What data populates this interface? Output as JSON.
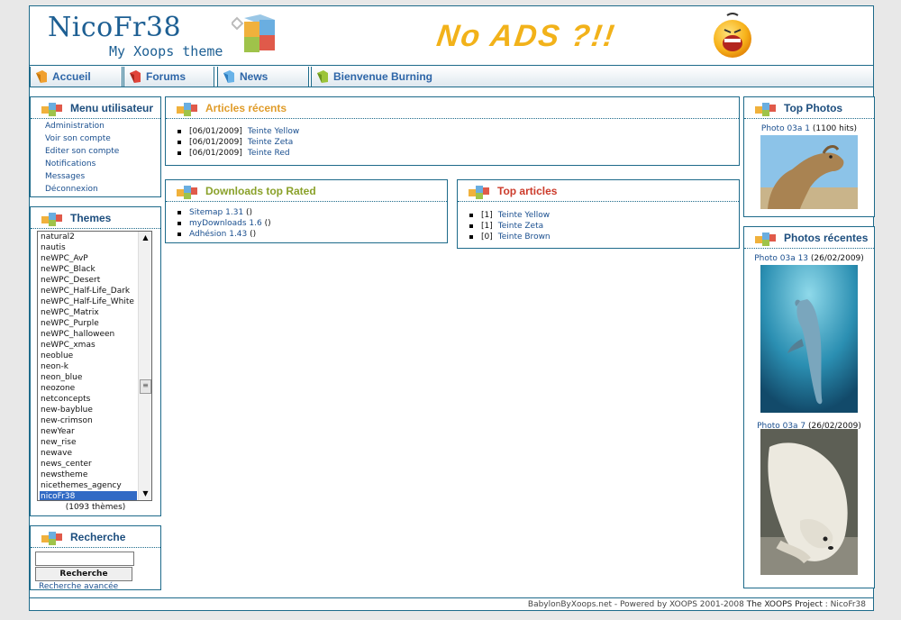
{
  "header": {
    "logo_title": "NicoFr38",
    "logo_subtitle": "My Xoops theme",
    "banner_text": "No ADS ?!!"
  },
  "nav": {
    "items": [
      {
        "label": "Accueil",
        "icon": "orange-arrow-icon"
      },
      {
        "label": "Forums",
        "icon": "red-arrow-icon"
      },
      {
        "label": "News",
        "icon": "blue-arrow-icon"
      },
      {
        "label": "Bienvenue Burning",
        "icon": "green-arrow-icon"
      }
    ]
  },
  "user_menu": {
    "title": "Menu utilisateur",
    "links": [
      "Administration",
      "Voir son compte",
      "Editer son compte",
      "Notifications",
      "Messages",
      "Déconnexion"
    ]
  },
  "themes": {
    "title": "Themes",
    "options": [
      "natural2",
      "nautis",
      "neWPC_AvP",
      "neWPC_Black",
      "neWPC_Desert",
      "neWPC_Half-Life_Dark",
      "neWPC_Half-Life_White",
      "neWPC_Matrix",
      "neWPC_Purple",
      "neWPC_halloween",
      "neWPC_xmas",
      "neoblue",
      "neon-k",
      "neon_blue",
      "neozone",
      "netconcepts",
      "new-bayblue",
      "new-crimson",
      "newYear",
      "new_rise",
      "newave",
      "news_center",
      "newstheme",
      "nicethemes_agency",
      "nicoFr38"
    ],
    "selected": "nicoFr38",
    "count_text": "(1093 thèmes)"
  },
  "search": {
    "title": "Recherche",
    "input_value": "",
    "button_label": "Recherche",
    "advanced_link": "Recherche avancée"
  },
  "recent_articles": {
    "title": "Articles récents",
    "items": [
      {
        "date": "[06/01/2009]",
        "title": "Teinte Yellow"
      },
      {
        "date": "[06/01/2009]",
        "title": "Teinte Zeta"
      },
      {
        "date": "[06/01/2009]",
        "title": "Teinte Red"
      }
    ]
  },
  "downloads": {
    "title": "Downloads top Rated",
    "items": [
      {
        "name": "Sitemap 1.31",
        "suffix": " ()"
      },
      {
        "name": "myDownloads 1.6",
        "suffix": " ()"
      },
      {
        "name": "Adhésion 1.43",
        "suffix": " ()"
      }
    ]
  },
  "top_articles": {
    "title": "Top articles",
    "items": [
      {
        "rank": "[1]",
        "title": "Teinte Yellow"
      },
      {
        "rank": "[1]",
        "title": "Teinte Zeta"
      },
      {
        "rank": "[0]",
        "title": "Teinte Brown"
      }
    ]
  },
  "top_photos": {
    "title": "Top Photos",
    "items": [
      {
        "link": "Photo 03a 1",
        "info": " (1100 hits)",
        "subject": "camel"
      }
    ]
  },
  "recent_photos": {
    "title": "Photos récentes",
    "items": [
      {
        "link": "Photo 03a 13",
        "info": " (26/02/2009)",
        "subject": "dolphin"
      },
      {
        "link": "Photo 03a 7",
        "info": " (26/02/2009)",
        "subject": "polar bear"
      }
    ]
  },
  "footer": {
    "text": "BabylonByXoops.net - Powered by XOOPS 2001-2008 ",
    "project": "The XOOPS Project",
    "author": " : NicoFr38"
  },
  "colors": {
    "border": "#1d6a8a",
    "link": "#1a4f8f",
    "title_blue": "#1d4e7e",
    "green_title": "#8aa12a",
    "orange_title": "#e09c2a",
    "red_title": "#cc3b2b"
  }
}
